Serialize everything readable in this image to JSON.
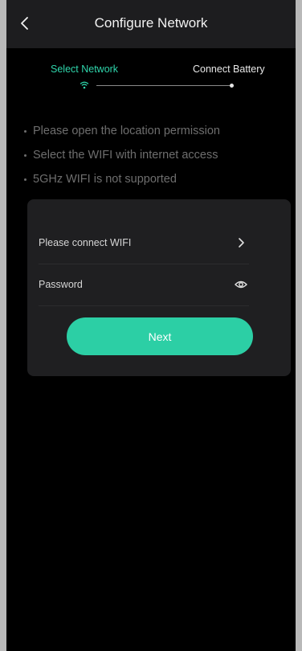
{
  "header": {
    "title": "Configure Network",
    "back_icon": "chevron-left-icon"
  },
  "steps": [
    {
      "label": "Select Network",
      "icon": "wifi-icon",
      "active": true,
      "color": "#2fd6ac"
    },
    {
      "label": "Connect Battery",
      "icon": "dot",
      "active": false
    }
  ],
  "tips": [
    "Please open the location permission",
    "Select the WIFI with internet access",
    "5GHz WIFI is not supported"
  ],
  "form": {
    "wifi_label": "Please connect WIFI",
    "wifi_icon": "chevron-right-icon",
    "password_placeholder": "Password",
    "password_value": "",
    "password_icon": "eye-icon",
    "next_label": "Next"
  },
  "colors": {
    "accent": "#2ccfa5",
    "background": "#000000",
    "header_bg": "#1d1d1f",
    "card_bg": "#1f1f21",
    "tip_text": "#6e6e6e"
  }
}
